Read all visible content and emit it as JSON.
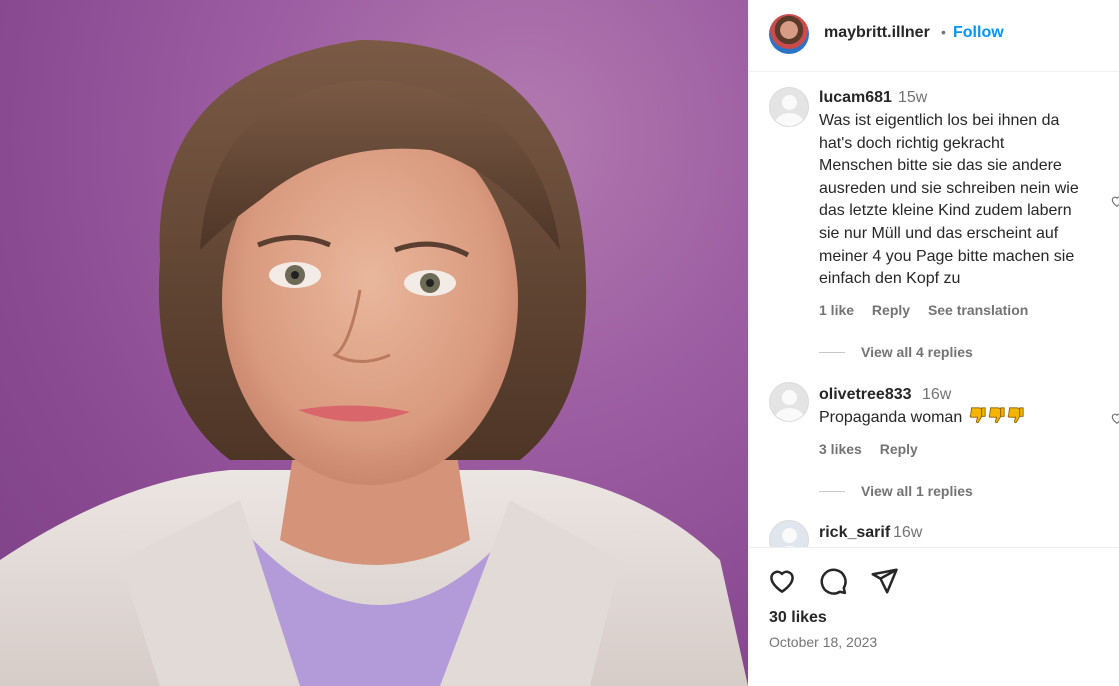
{
  "post": {
    "username": "maybritt.illner",
    "separator": "•",
    "follow_label": "Follow"
  },
  "comments": [
    {
      "username": "lucam681",
      "time": "15w",
      "text_lines": [
        "Was ist eigentlich los bei ihnen da",
        "hat's doch richtig gekracht",
        "Menschen bitte sie das sie andere",
        "ausreden und sie schreiben nein wie",
        "das letzte kleine Kind zudem labern",
        "sie nur Müll und das erscheint auf",
        "meiner 4 you Page bitte machen sie",
        "einfach den Kopf zu"
      ],
      "likes": "1 like",
      "reply": "Reply",
      "translate": "See translation",
      "view_replies": "View all 4 replies"
    },
    {
      "username": "olivetree833",
      "time": "16w",
      "text": "Propaganda woman",
      "emoji": "thumbs-down x3",
      "likes": "3 likes",
      "reply": "Reply",
      "view_replies": "View all 1 replies"
    },
    {
      "username": "rick_sarif",
      "time": "16w"
    }
  ],
  "footer": {
    "likes": "30 likes",
    "date": "October 18, 2023"
  },
  "icons": {
    "like": "heart-icon",
    "comment": "comment-icon",
    "share": "share-icon"
  },
  "colors": {
    "accent": "#0095f6",
    "secondary_text": "#737373",
    "background_photo": "#9d5ea2"
  }
}
